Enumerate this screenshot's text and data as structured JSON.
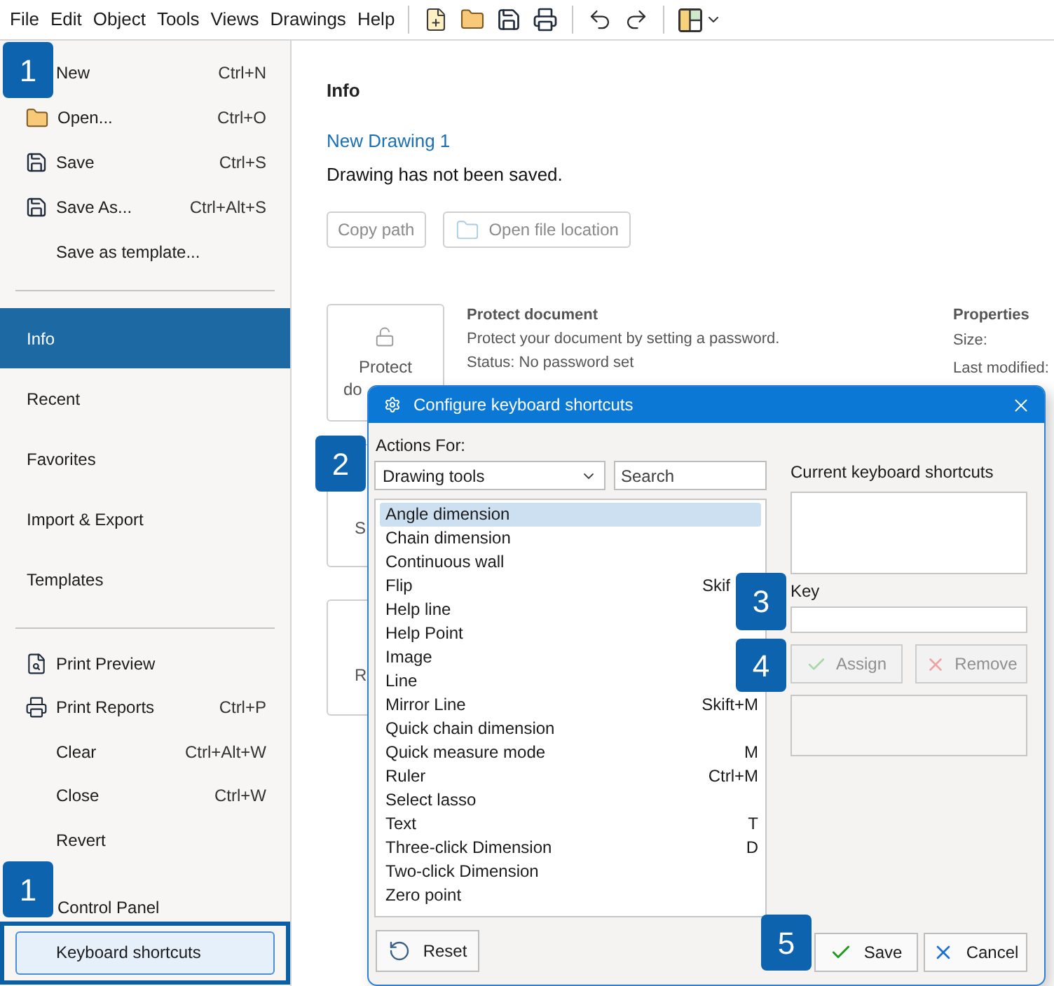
{
  "menu_bar": {
    "menus": [
      "File",
      "Edit",
      "Object",
      "Tools",
      "Views",
      "Drawings",
      "Help"
    ]
  },
  "sidebar": {
    "file_items": [
      {
        "label": "New",
        "shortcut": "Ctrl+N"
      },
      {
        "label": "Open...",
        "shortcut": "Ctrl+O"
      },
      {
        "label": "Save",
        "shortcut": "Ctrl+S"
      },
      {
        "label": "Save As...",
        "shortcut": "Ctrl+Alt+S"
      },
      {
        "label": "Save as template..."
      }
    ],
    "sections": [
      {
        "label": "Info",
        "selected": true
      },
      {
        "label": "Recent",
        "selected": false
      },
      {
        "label": "Favorites",
        "selected": false
      },
      {
        "label": "Import & Export",
        "selected": false
      },
      {
        "label": "Templates",
        "selected": false
      }
    ],
    "commands": [
      {
        "label": "Print Preview"
      },
      {
        "label": "Print Reports",
        "shortcut": "Ctrl+P"
      },
      {
        "label": "Clear",
        "shortcut": "Ctrl+Alt+W"
      },
      {
        "label": "Close",
        "shortcut": "Ctrl+W"
      },
      {
        "label": "Revert"
      }
    ],
    "settings_items": [
      {
        "label": "Control Panel",
        "highlighted": false,
        "framed": false
      },
      {
        "label": "Keyboard shortcuts",
        "highlighted": true,
        "framed": true
      }
    ]
  },
  "info": {
    "heading": "Info",
    "file_name": "New Drawing 1",
    "save_status": "Drawing has not been saved.",
    "buttons": [
      {
        "label": "Copy path",
        "disabled": true
      },
      {
        "label": "Open file location",
        "disabled": true
      }
    ],
    "cards": [
      {
        "label_lines": [
          "Protect",
          "do"
        ],
        "title": "Protect document",
        "description": "Protect your document by setting a password.",
        "status": "Status: No password set"
      },
      {
        "label_lines": [
          "S"
        ]
      },
      {
        "label_lines": [
          "R"
        ]
      }
    ],
    "properties": {
      "title": "Properties",
      "fields": [
        "Size:",
        "Last modified:"
      ]
    }
  },
  "dialog": {
    "title": "Configure keyboard shortcuts",
    "actions_label": "Actions For:",
    "category": {
      "value": "Drawing tools"
    },
    "search": {
      "placeholder": "Search"
    },
    "actions": [
      {
        "name": "Angle dimension",
        "selected": true
      },
      {
        "name": "Chain dimension",
        "selected": false
      },
      {
        "name": "Continuous wall",
        "selected": false
      },
      {
        "name": "Flip",
        "shortcut": "Skif",
        "shortcut_cut": true,
        "selected": false
      },
      {
        "name": "Help line",
        "selected": false
      },
      {
        "name": "Help Point",
        "selected": false
      },
      {
        "name": "Image",
        "selected": false
      },
      {
        "name": "Line",
        "selected": false
      },
      {
        "name": "Mirror Line",
        "shortcut": "Skift+M",
        "selected": false
      },
      {
        "name": "Quick chain dimension",
        "selected": false
      },
      {
        "name": "Quick measure mode",
        "shortcut": "M",
        "selected": false
      },
      {
        "name": "Ruler",
        "shortcut": "Ctrl+M",
        "selected": false
      },
      {
        "name": "Select lasso",
        "selected": false
      },
      {
        "name": "Text",
        "shortcut": "T",
        "selected": false
      },
      {
        "name": "Three-click Dimension",
        "shortcut": "D",
        "selected": false
      },
      {
        "name": "Two-click Dimension",
        "selected": false
      },
      {
        "name": "Zero point",
        "selected": false
      }
    ],
    "current_shortcuts_label": "Current keyboard shortcuts",
    "key_label": "Key",
    "edit_buttons": [
      {
        "label": "Assign",
        "disabled": true
      },
      {
        "label": "Remove",
        "disabled": true
      }
    ],
    "reset_button": "Reset",
    "footer_buttons": [
      "Save",
      "Cancel"
    ]
  },
  "callouts": [
    "1",
    "2",
    "3",
    "4",
    "5",
    "1"
  ]
}
